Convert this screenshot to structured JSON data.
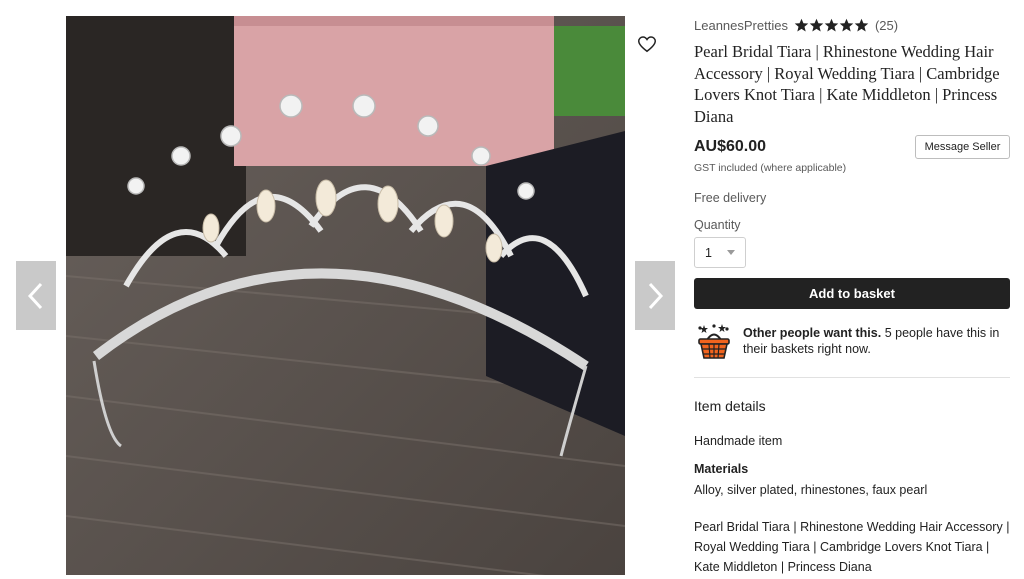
{
  "gallery": {
    "prev_icon": "chevron-left-icon",
    "next_icon": "chevron-right-icon",
    "favorite_icon": "heart-outline-icon",
    "image_alt": "Pearl Bridal Tiara"
  },
  "listing": {
    "seller_name": "LeannesPretties",
    "rating_stars": 5,
    "review_count": "(25)",
    "title": "Pearl Bridal Tiara | Rhinestone Wedding Hair Accessory | Royal Wedding Tiara | Cambridge Lovers Knot Tiara | Kate Middleton | Princess Diana",
    "price": "AU$60.00",
    "message_seller_label": "Message Seller",
    "gst_note": "GST included (where applicable)",
    "delivery": "Free delivery",
    "quantity_label": "Quantity",
    "quantity_value": "1",
    "add_to_basket_label": "Add to basket"
  },
  "demand": {
    "icon": "basket-icon",
    "headline": "Other people want this.",
    "body": " 5 people have this in their baskets right now."
  },
  "item_details": {
    "heading": "Item details",
    "handmade": "Handmade item",
    "materials_heading": "Materials",
    "materials": "Alloy, silver plated, rhinestones, faux pearl",
    "description": "Pearl Bridal Tiara | Rhinestone Wedding Hair Accessory | Royal Wedding Tiara | Cambridge Lovers Knot Tiara | Kate Middleton | Princess Diana"
  },
  "colors": {
    "button_dark": "#222222",
    "nav_button": "#c9c9c9",
    "star": "#222222"
  }
}
